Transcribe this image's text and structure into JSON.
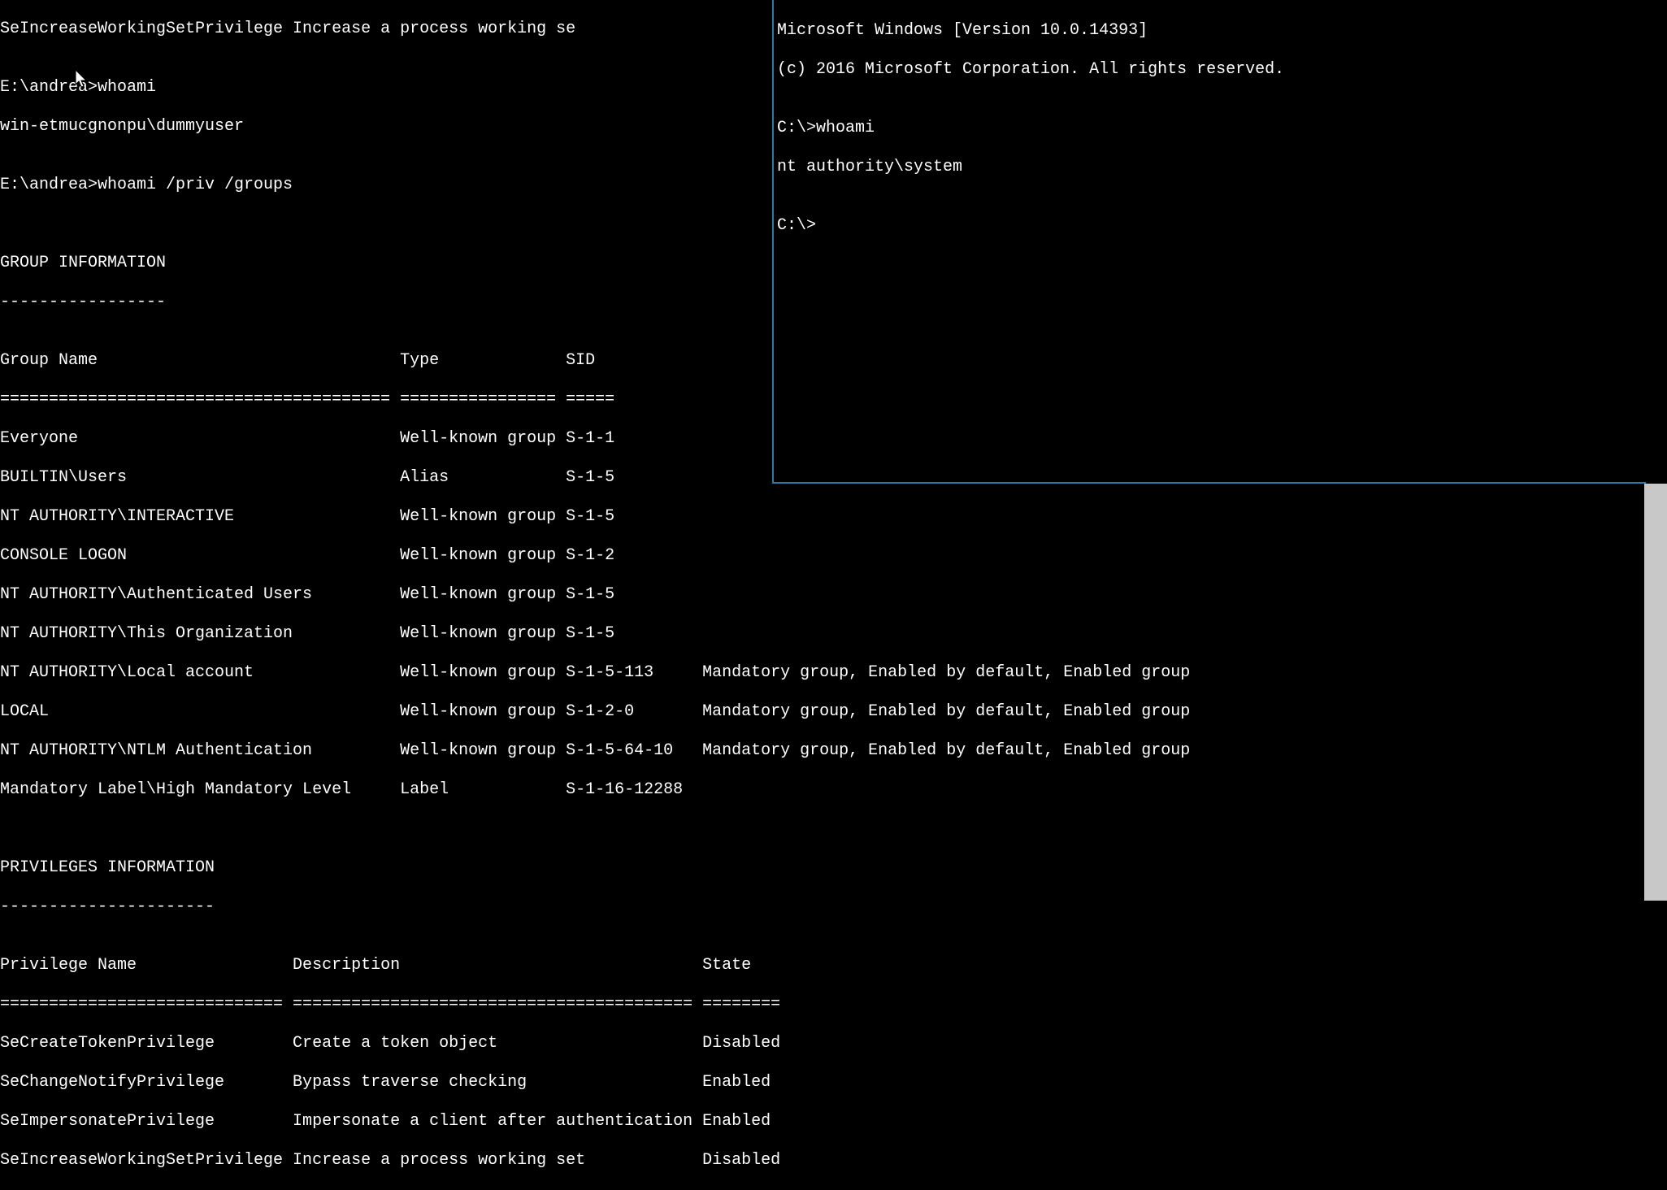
{
  "left": {
    "truncated_top": "SeIncreaseWorkingSetPrivilege Increase a process working se",
    "blank1": "",
    "prompt1": "E:\\andrea>whoami",
    "result1": "win-etmucgnonpu\\dummyuser",
    "blank2": "",
    "prompt2": "E:\\andrea>whoami /priv /groups",
    "blank3": "",
    "blank4": "",
    "group_header": "GROUP INFORMATION",
    "group_dashes": "-----------------",
    "blank5": "",
    "group_cols": "Group Name                               Type             SID",
    "group_sep": "======================================== ================ =====",
    "grp_rows": [
      "Everyone                                 Well-known group S-1-1",
      "BUILTIN\\Users                            Alias            S-1-5",
      "NT AUTHORITY\\INTERACTIVE                 Well-known group S-1-5",
      "CONSOLE LOGON                            Well-known group S-1-2",
      "NT AUTHORITY\\Authenticated Users         Well-known group S-1-5",
      "NT AUTHORITY\\This Organization           Well-known group S-1-5",
      "NT AUTHORITY\\Local account               Well-known group S-1-5-113     Mandatory group, Enabled by default, Enabled group",
      "LOCAL                                    Well-known group S-1-2-0       Mandatory group, Enabled by default, Enabled group",
      "NT AUTHORITY\\NTLM Authentication         Well-known group S-1-5-64-10   Mandatory group, Enabled by default, Enabled group",
      "Mandatory Label\\High Mandatory Level     Label            S-1-16-12288"
    ],
    "blank6": "",
    "blank7": "",
    "priv_header": "PRIVILEGES INFORMATION",
    "priv_dashes": "----------------------",
    "blank8": "",
    "priv_cols": "Privilege Name                Description                               State",
    "priv_sep": "============================= ========================================= ========",
    "priv_rows": [
      "SeCreateTokenPrivilege        Create a token object                     Disabled",
      "SeChangeNotifyPrivilege       Bypass traverse checking                  Enabled",
      "SeImpersonatePrivilege        Impersonate a client after authentication Enabled",
      "SeIncreaseWorkingSetPrivilege Increase a process working set            Disabled"
    ]
  },
  "right": {
    "banner1": "Microsoft Windows [Version 10.0.14393]",
    "banner2": "(c) 2016 Microsoft Corporation. All rights reserved.",
    "blank1": "",
    "prompt1": "C:\\>whoami",
    "result1": "nt authority\\system",
    "blank2": "",
    "prompt2": "C:\\>"
  }
}
